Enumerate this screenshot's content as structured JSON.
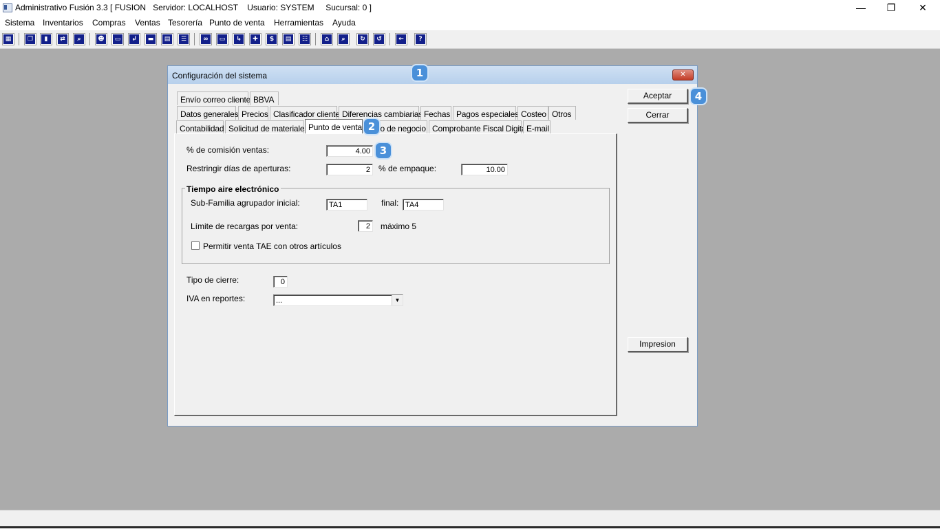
{
  "window": {
    "title": "Administrativo Fusión 3.3 [ FUSION   Servidor: LOCALHOST    Usuario: SYSTEM     Sucursal: 0 ]",
    "minimize": "—",
    "maximize": "❐",
    "close": "✕"
  },
  "menu": [
    "Sistema",
    "Inventarios",
    "Compras",
    "Ventas",
    "Tesorería",
    "Punto de venta",
    "Herramientas",
    "Ayuda"
  ],
  "toolbar_icons": [
    "calculator-icon",
    "copy-icon",
    "delete-icon",
    "transfer-icon",
    "search-icon",
    "user-icon",
    "folder-icon",
    "import-icon",
    "print-icon",
    "document-icon",
    "report-icon",
    "binoculars-icon",
    "folder-open-icon",
    "export-icon",
    "add-icon",
    "money-icon",
    "page-icon",
    "list-icon",
    "home-icon",
    "zoom-icon",
    "refresh-icon",
    "undo-icon",
    "back-icon",
    "help-icon"
  ],
  "dialog": {
    "title": "Configuración del sistema",
    "close_glyph": "✕",
    "markers": [
      "1",
      "2",
      "3",
      "4"
    ],
    "tabs_row1": [
      "Envío correo cliente",
      "BBVA"
    ],
    "tabs_row2": [
      "Datos generales",
      "Precios",
      "Clasificador cliente",
      "Diferencias cambiarias",
      "Fechas",
      "Pagos especiales",
      "Costeo",
      "Otros"
    ],
    "tabs_row3": [
      "Contabilidad",
      "Solicitud de materiales",
      "Punto de venta",
      "io de negocio",
      "Comprobante Fiscal Digital",
      "E-mail"
    ],
    "active_tab": "Punto de venta",
    "fields": {
      "comision_label": "% de comisión ventas:",
      "comision_value": "4.00",
      "restringir_label": "Restringir días de aperturas:",
      "restringir_value": "2",
      "empaque_label": "% de empaque:",
      "empaque_value": "10.00",
      "group_title": "Tiempo aire electrónico",
      "subfamilia_label": "Sub-Familia agrupador inicial:",
      "subfamilia_inicial": "TA1",
      "final_label": "final:",
      "subfamilia_final": "TA4",
      "limite_label": "Límite de recargas por venta:",
      "limite_value": "2",
      "maximo_label": "máximo 5",
      "permitir_label": "Permitir venta TAE con otros artículos",
      "permitir_checked": false,
      "tipo_cierre_label": "Tipo de cierre:",
      "tipo_cierre_value": "0",
      "iva_label": "IVA en reportes:",
      "iva_value": "..."
    },
    "buttons": {
      "aceptar": "Aceptar",
      "cerrar": "Cerrar",
      "impresion": "Impresion"
    }
  }
}
